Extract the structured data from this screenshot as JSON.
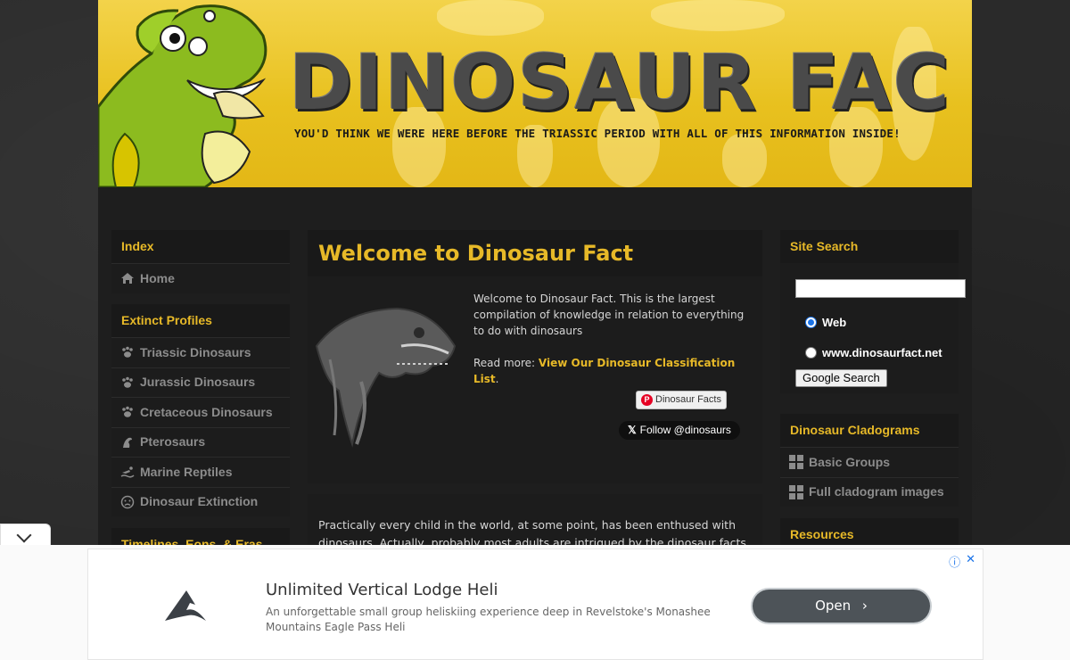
{
  "banner": {
    "title": "DINOSAUR FACTS",
    "tagline": "YOU'D THINK WE WERE HERE BEFORE THE TRIASSIC PERIOD WITH ALL OF THIS INFORMATION INSIDE!"
  },
  "left_sidebar": {
    "index": {
      "heading": "Index",
      "items": [
        {
          "icon": "house-icon",
          "label": "Home"
        }
      ]
    },
    "extinct": {
      "heading": "Extinct Profiles",
      "items": [
        {
          "icon": "paw-icon",
          "label": "Triassic Dinosaurs"
        },
        {
          "icon": "paw-icon",
          "label": "Jurassic Dinosaurs"
        },
        {
          "icon": "paw-icon",
          "label": "Cretaceous Dinosaurs"
        },
        {
          "icon": "pterosaur-icon",
          "label": "Pterosaurs"
        },
        {
          "icon": "swimmer-icon",
          "label": "Marine Reptiles"
        },
        {
          "icon": "frown-icon",
          "label": "Dinosaur Extinction"
        }
      ]
    },
    "timelines": {
      "heading": "Timelines, Eons, & Eras"
    }
  },
  "main": {
    "title": "Welcome to Dinosaur Fact",
    "intro": "Welcome to Dinosaur Fact. This is the largest compilation of knowledge in relation to everything to do with dinosaurs",
    "read_more_prefix": "Read more: ",
    "read_more_link": "View Our Dinosaur Classification List",
    "read_more_suffix": ".",
    "pinterest_label": "Dinosaur Facts",
    "x_follow_label": "Follow @dinosaurs",
    "paragraph": "Practically every child in the world, at some point, has been enthused with dinosaurs. Actually, probably most adults are intrigued by the dinosaur facts"
  },
  "right_sidebar": {
    "search": {
      "heading": "Site Search",
      "input_value": "",
      "option_web": "Web",
      "option_site": "www.dinosaurfact.net",
      "selected": "Web",
      "button": "Google Search"
    },
    "cladograms": {
      "heading": "Dinosaur Cladograms",
      "items": [
        {
          "icon": "grid-icon",
          "label": "Basic Groups"
        },
        {
          "icon": "grid-icon",
          "label": "Full cladogram images"
        }
      ]
    },
    "resources": {
      "heading": "Resources"
    }
  },
  "ad": {
    "title": "Unlimited Vertical Lodge Heli",
    "description": "An unforgettable small group heliskiing experience deep in Revelstoke's Monashee Mountains Eagle Pass Heli",
    "button": "Open"
  },
  "colors": {
    "accent": "#e7b928",
    "panel": "#1c1c1c",
    "banner": "#e8c11f"
  }
}
